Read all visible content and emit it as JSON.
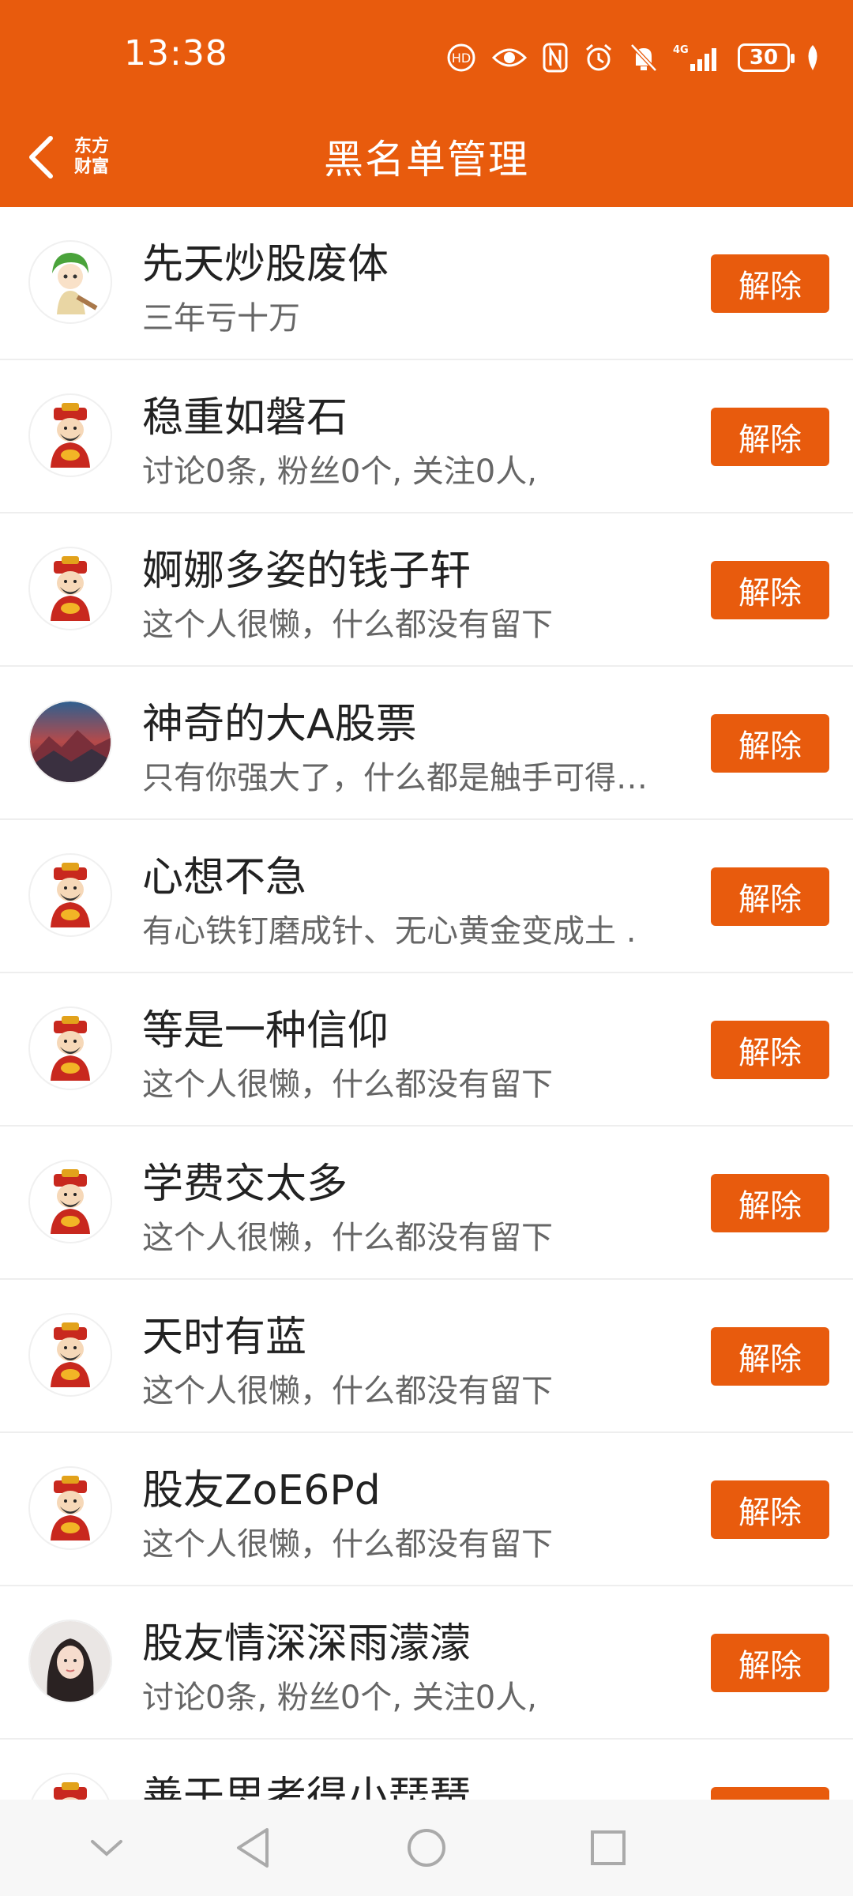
{
  "status_bar": {
    "time": "13:38",
    "battery": "30",
    "icons": [
      "hd-icon",
      "eye-icon",
      "nfc-icon",
      "alarm-icon",
      "silent-icon",
      "signal-4g-icon",
      "battery-icon",
      "leaf-icon"
    ]
  },
  "header": {
    "title": "黑名单管理",
    "logo_line1": "东方",
    "logo_line2": "财富"
  },
  "remove_label": "解除",
  "items": [
    {
      "name": "先天炒股废体",
      "desc": "三年亏十万",
      "avatar": "anime-avatar"
    },
    {
      "name": "稳重如磐石",
      "desc": "讨论0条, 粉丝0个, 关注0人,",
      "avatar": "default-avatar"
    },
    {
      "name": "婀娜多姿的钱子轩",
      "desc": "这个人很懒，什么都没有留下",
      "avatar": "default-avatar"
    },
    {
      "name": "神奇的大A股票",
      "desc": "只有你强大了，什么都是触手可得…",
      "avatar": "landscape-avatar"
    },
    {
      "name": "心想不急",
      "desc": "有心铁钉磨成针、无心黄金变成土 .",
      "avatar": "default-avatar"
    },
    {
      "name": "等是一种信仰",
      "desc": "这个人很懒，什么都没有留下",
      "avatar": "default-avatar"
    },
    {
      "name": "学费交太多",
      "desc": "这个人很懒，什么都没有留下",
      "avatar": "default-avatar"
    },
    {
      "name": "天时有蓝",
      "desc": "这个人很懒，什么都没有留下",
      "avatar": "default-avatar"
    },
    {
      "name": "股友ZoE6Pd",
      "desc": "这个人很懒，什么都没有留下",
      "avatar": "default-avatar"
    },
    {
      "name": "股友情深深雨濛濛",
      "desc": "讨论0条, 粉丝0个, 关注0人,",
      "avatar": "photo-avatar"
    },
    {
      "name": "善于思考得小琵琶",
      "desc": "",
      "avatar": "default-avatar"
    }
  ],
  "colors": {
    "accent": "#E85B0D",
    "text": "#222222",
    "subtext": "#666666"
  }
}
